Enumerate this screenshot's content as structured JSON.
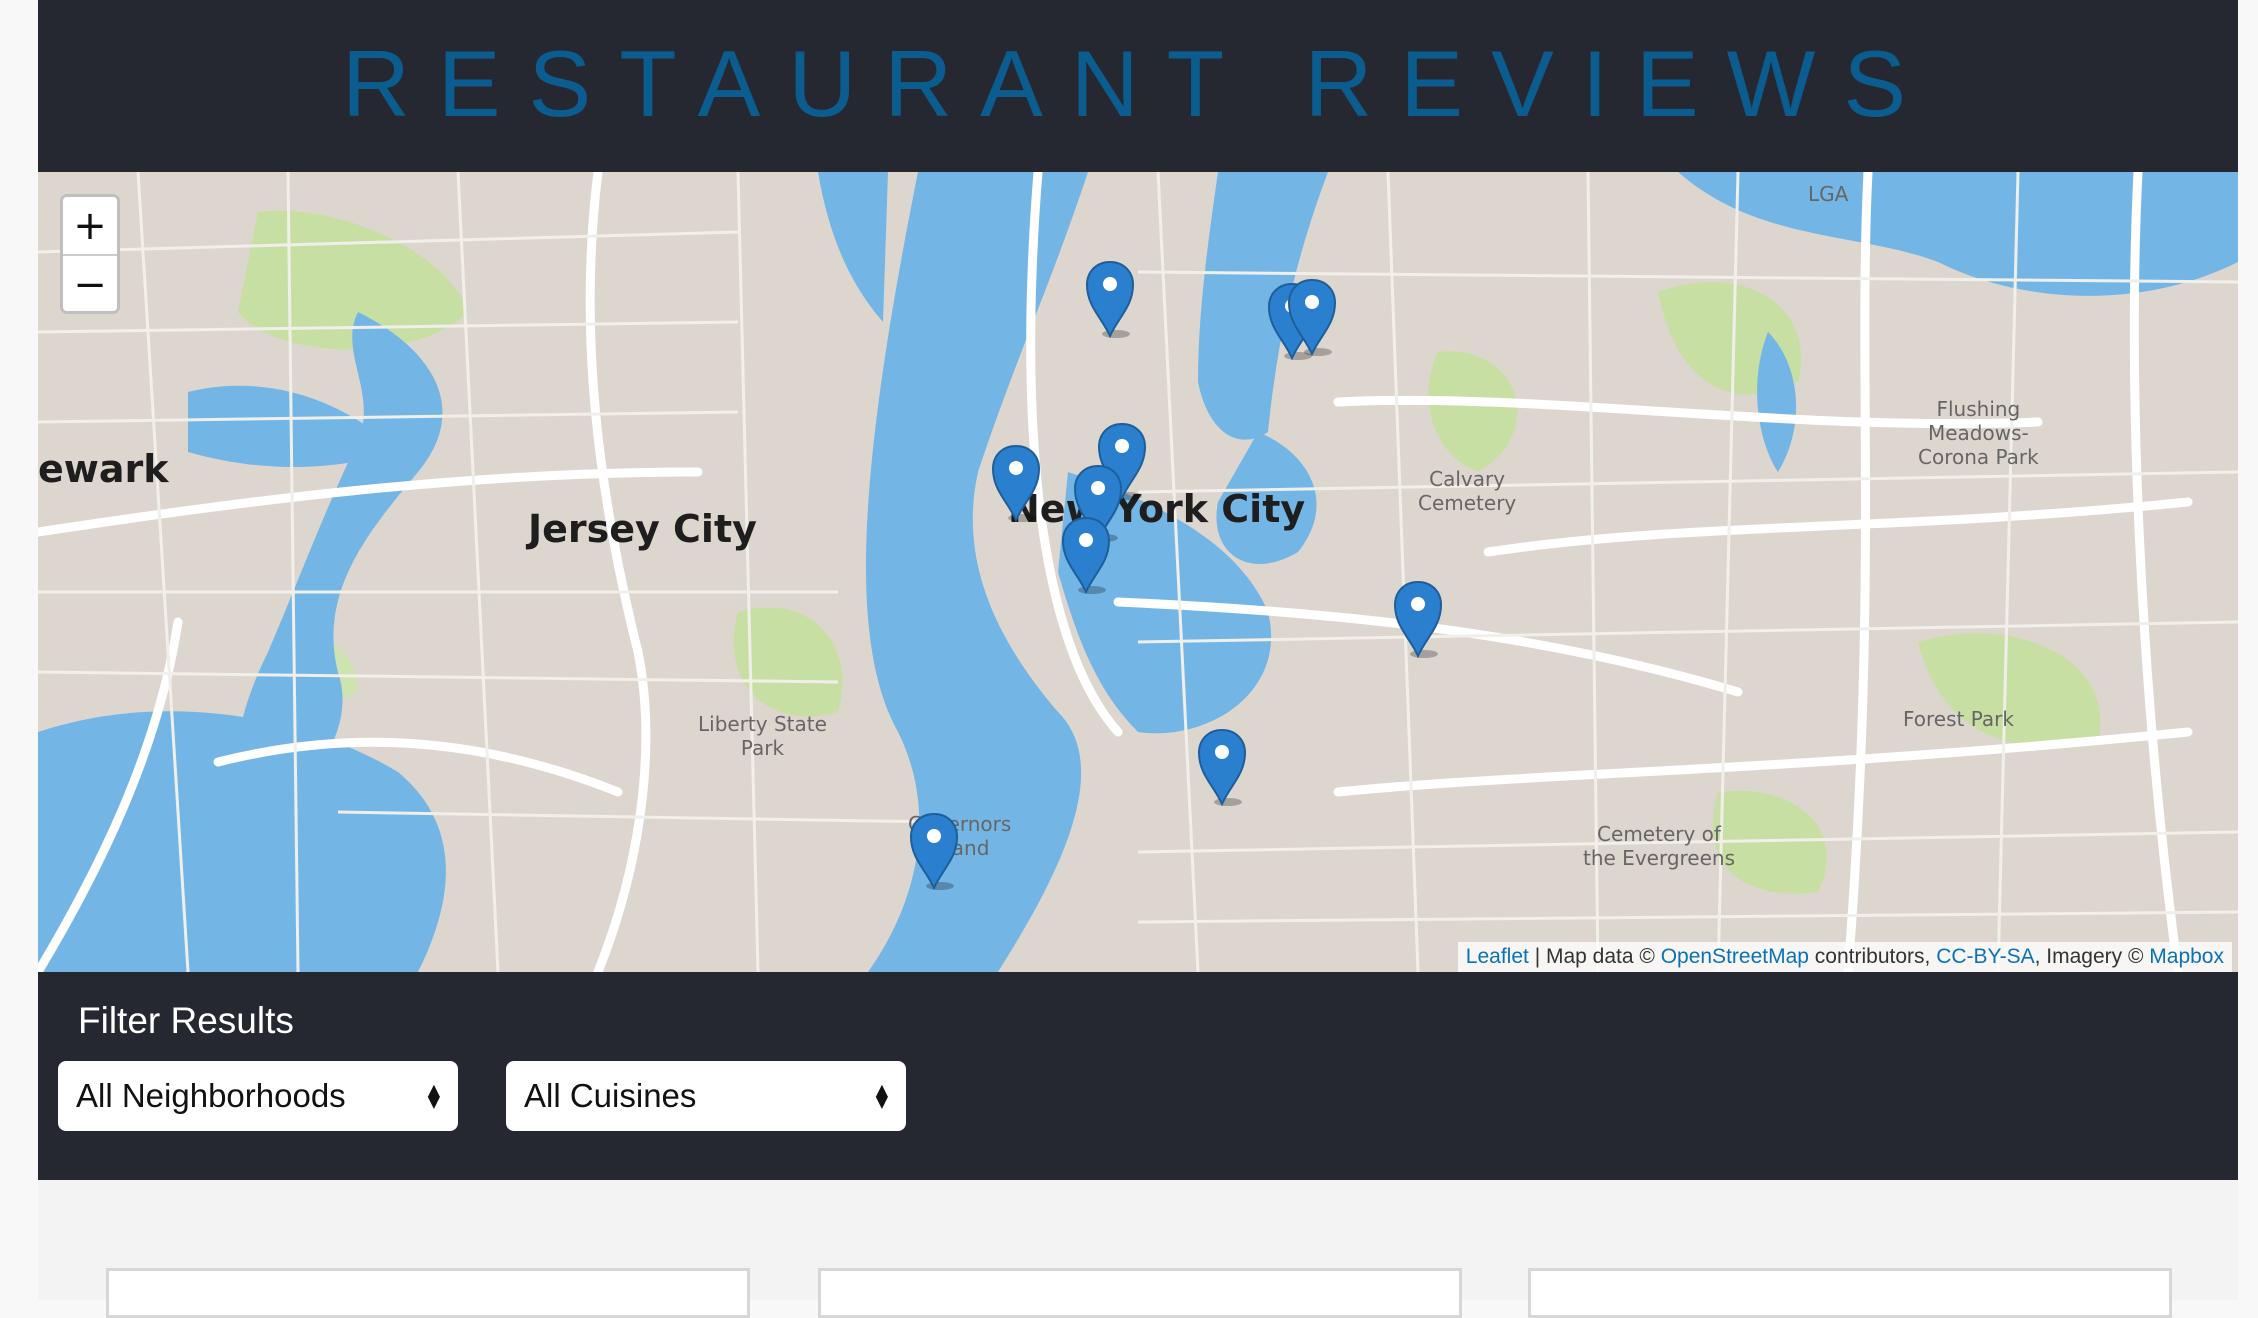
{
  "header": {
    "title": "RESTAURANT REVIEWS"
  },
  "map": {
    "zoom_in_label": "+",
    "zoom_out_label": "−",
    "labels": {
      "newark": "ewark",
      "jersey_city": "Jersey City",
      "new_york_city": "New York City",
      "liberty_state_park": "Liberty State\nPark",
      "governors_island": "Governors\nIsland",
      "calvary_cemetery": "Calvary\nCemetery",
      "flushing_meadows": "Flushing\nMeadows-\nCorona Park",
      "forest_park": "Forest Park",
      "cemetery_evergreens": "Cemetery of\nthe Evergreens",
      "lga": "LGA"
    },
    "markers": [
      {
        "name": "marker-1"
      },
      {
        "name": "marker-2"
      },
      {
        "name": "marker-3"
      },
      {
        "name": "marker-4"
      },
      {
        "name": "marker-5"
      },
      {
        "name": "marker-6"
      },
      {
        "name": "marker-7"
      },
      {
        "name": "marker-8"
      },
      {
        "name": "marker-9"
      },
      {
        "name": "marker-10"
      }
    ],
    "attribution": {
      "leaflet": "Leaflet",
      "sep": " | Map data © ",
      "osm": "OpenStreetMap",
      "contributors": " contributors, ",
      "license": "CC-BY-SA",
      "imagery": ", Imagery © ",
      "mapbox": "Mapbox"
    }
  },
  "filter": {
    "title": "Filter Results",
    "neighborhood_value": "All Neighborhoods",
    "cuisine_value": "All Cuisines"
  },
  "colors": {
    "header_bg": "#252831",
    "title": "#0b5c8f",
    "water": "#73b6e6",
    "marker": "#2a7fcf"
  }
}
